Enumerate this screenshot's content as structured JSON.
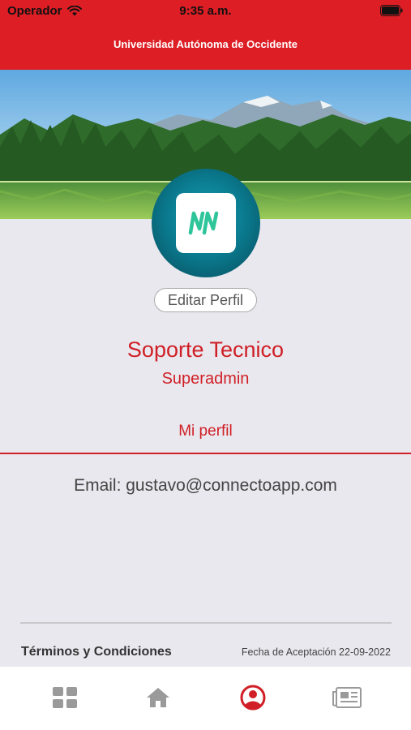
{
  "status_bar": {
    "carrier": "Operador",
    "time": "9:35 a.m."
  },
  "header": {
    "title": "Universidad Autónoma de Occidente"
  },
  "profile": {
    "edit_label": "Editar Perfil",
    "name": "Soporte Tecnico",
    "role": "Superadmin",
    "section_title": "Mi perfil",
    "email_text": "Email: gustavo@connectoapp.com"
  },
  "footer": {
    "terms_label": "Términos y Condiciones",
    "acceptance_date": "Fecha de Aceptación 22-09-2022"
  },
  "tabbar": {
    "tabs": [
      {
        "icon": "grid-icon",
        "active": false
      },
      {
        "icon": "home-icon",
        "active": false
      },
      {
        "icon": "profile-icon",
        "active": true
      },
      {
        "icon": "news-icon",
        "active": false
      }
    ],
    "active_color": "#d01f26",
    "inactive_color": "#9a9a9a"
  },
  "colors": {
    "brand_red": "#dd1e25",
    "avatar_teal": "#0b7d92",
    "logo_green": "#2ec59a"
  }
}
